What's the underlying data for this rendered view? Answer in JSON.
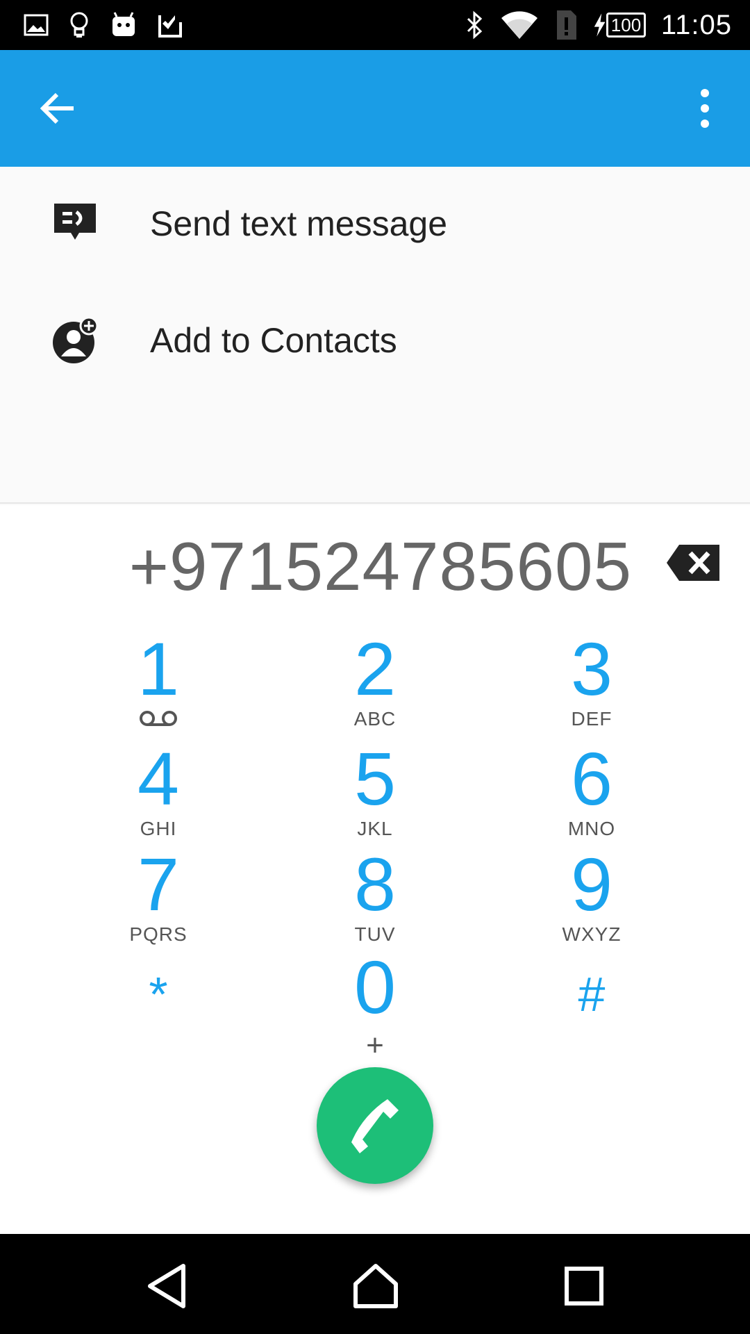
{
  "status_bar": {
    "icons_left": [
      "image-icon",
      "lightbulb-icon",
      "android-icon",
      "checkbox-icon"
    ],
    "icons_right": [
      "bluetooth-icon",
      "wifi-icon",
      "sim-alert-icon",
      "charging-icon"
    ],
    "battery": "100",
    "time": "11:05"
  },
  "app_bar": {
    "color": "#1a9de6"
  },
  "actions": [
    {
      "label": "Send text message",
      "icon": "message-icon"
    },
    {
      "label": "Add to Contacts",
      "icon": "add-contact-icon"
    }
  ],
  "dialer": {
    "number": "+971524785605",
    "keys": [
      {
        "digit": "1",
        "letters": ""
      },
      {
        "digit": "2",
        "letters": "ABC"
      },
      {
        "digit": "3",
        "letters": "DEF"
      },
      {
        "digit": "4",
        "letters": "GHI"
      },
      {
        "digit": "5",
        "letters": "JKL"
      },
      {
        "digit": "6",
        "letters": "MNO"
      },
      {
        "digit": "7",
        "letters": "PQRS"
      },
      {
        "digit": "8",
        "letters": "TUV"
      },
      {
        "digit": "9",
        "letters": "WXYZ"
      },
      {
        "digit": "*",
        "letters": ""
      },
      {
        "digit": "0",
        "letters": ""
      },
      {
        "digit": "#",
        "letters": ""
      }
    ],
    "zero_sub": "+",
    "accent": "#1aa3ee",
    "call_color": "#1dbf78"
  }
}
